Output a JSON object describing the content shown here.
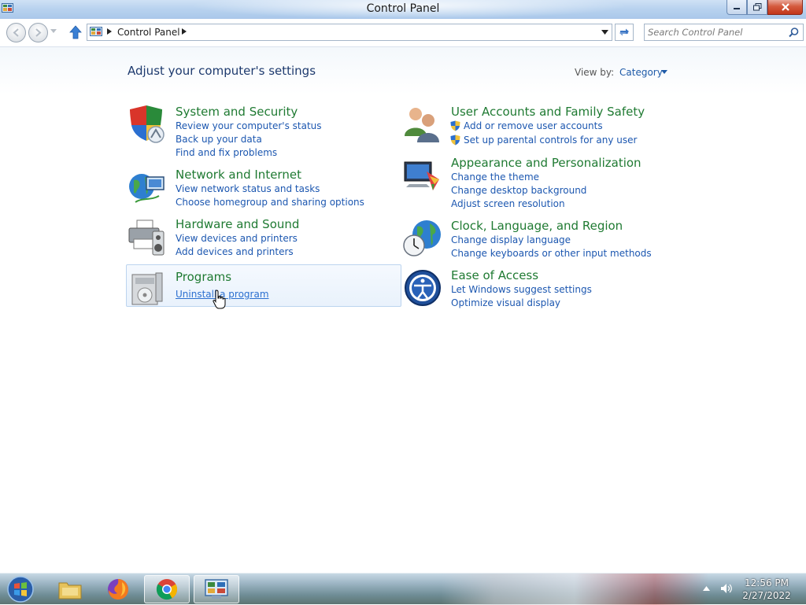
{
  "window": {
    "title": "Control Panel",
    "buttons": {
      "minimize": "minimize",
      "maximize": "maximize",
      "close": "close"
    }
  },
  "address_bar": {
    "breadcrumb": "Control Panel",
    "search_placeholder": "Search Control Panel"
  },
  "main": {
    "heading": "Adjust your computer's settings",
    "view_by_label": "View by:",
    "view_by_value": "Category",
    "left_categories": [
      {
        "title": "System and Security",
        "icon": "security-shield-icon",
        "links": [
          "Review your computer's status",
          "Back up your data",
          "Find and fix problems"
        ]
      },
      {
        "title": "Network and Internet",
        "icon": "network-globe-icon",
        "links": [
          "View network status and tasks",
          "Choose homegroup and sharing options"
        ]
      },
      {
        "title": "Hardware and Sound",
        "icon": "printer-speaker-icon",
        "links": [
          "View devices and printers",
          "Add devices and printers"
        ]
      },
      {
        "title": "Programs",
        "icon": "programs-box-icon",
        "links": [
          "Uninstall a program"
        ],
        "hovered": true
      }
    ],
    "right_categories": [
      {
        "title": "User Accounts and Family Safety",
        "icon": "users-icon",
        "links": [
          "Add or remove user accounts",
          "Set up parental controls for any user"
        ]
      },
      {
        "title": "Appearance and Personalization",
        "icon": "monitor-palette-icon",
        "links": [
          "Change the theme",
          "Change desktop background",
          "Adjust screen resolution"
        ]
      },
      {
        "title": "Clock, Language, and Region",
        "icon": "clock-globe-icon",
        "links": [
          "Change display language",
          "Change keyboards or other input methods"
        ]
      },
      {
        "title": "Ease of Access",
        "icon": "ease-of-access-icon",
        "links": [
          "Let Windows suggest settings",
          "Optimize visual display"
        ]
      }
    ]
  },
  "taskbar": {
    "items": [
      "file-explorer",
      "firefox",
      "chrome",
      "control-panel"
    ],
    "active_item": "control-panel",
    "clock_time": "12:56 PM",
    "clock_date": "2/27/2022"
  },
  "colors": {
    "category_title": "#1f7a32",
    "link": "#1c57b0",
    "heading": "#1e3a6e"
  }
}
